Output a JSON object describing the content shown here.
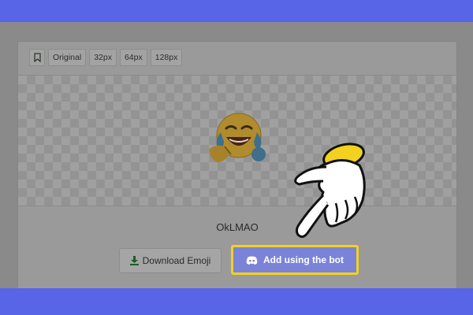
{
  "toolbar": {
    "bookmark_icon": "bookmark-icon",
    "sizes": [
      "Original",
      "32px",
      "64px",
      "128px"
    ]
  },
  "emoji": {
    "name": "OkLMAO",
    "image": "laughing-crying-emoji-pointing"
  },
  "actions": {
    "download_label": "Download Emoji",
    "download_icon": "download-icon",
    "add_bot_label": "Add using the bot",
    "add_bot_icon": "discord-icon"
  },
  "colors": {
    "frame_band": "#5865e6",
    "overlay": "#8a8a8a",
    "highlight_border": "#f2d21e",
    "bot_button": "#7b83d8"
  },
  "annotation": {
    "pointer": "pointing-hand-icon"
  }
}
